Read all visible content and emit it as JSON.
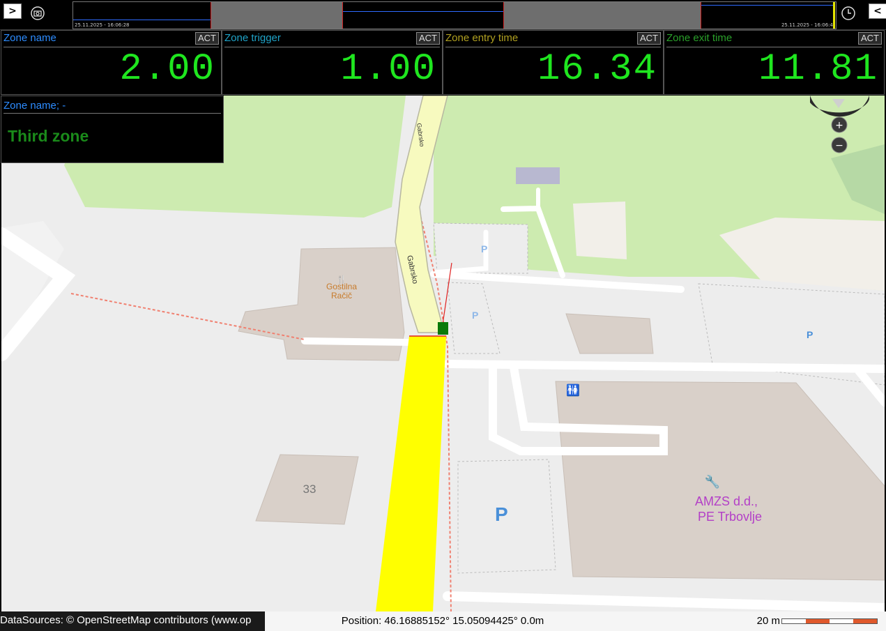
{
  "topbar": {
    "left_button": ">",
    "right_button": "<",
    "left_icon": "camera-icon",
    "right_icon": "clock-icon",
    "timeline_start": "25.11.2025 - 16:06:28",
    "timeline_end": "25.11.2025 - 16:06:4"
  },
  "panels": [
    {
      "label": "Zone name",
      "value": "2.00",
      "act": "ACT",
      "label_color": "#2d8cff"
    },
    {
      "label": "Zone trigger",
      "value": "1.00",
      "act": "ACT",
      "label_color": "#1fa3c8"
    },
    {
      "label": "Zone entry time",
      "value": "16.34",
      "act": "ACT",
      "label_color": "#b0a020"
    },
    {
      "label": "Zone exit time",
      "value": "11.81",
      "act": "ACT",
      "label_color": "#2aa02a"
    }
  ],
  "zone_box": {
    "label": "Zone name; -",
    "value": "Third zone"
  },
  "map": {
    "street_labels": [
      "Gabrsko",
      "Gabrsko"
    ],
    "poi_restaurant": [
      "Gostilna",
      "Račič"
    ],
    "poi_company": [
      "AMZS d.d.,",
      "PE Trbovlje"
    ],
    "house_number": "33",
    "parking_label": "P",
    "zoom_in": "+",
    "zoom_out": "−"
  },
  "status": {
    "attribution": "DataSources: © OpenStreetMap contributors (www.op",
    "position": "Position: 46.16885152° 15.05094425° 0.0m",
    "scale_label": "20 m"
  },
  "colors": {
    "value_green": "#1fe61f",
    "zone_yellow": "#ffff00",
    "marker_green": "#0a7a0a"
  }
}
